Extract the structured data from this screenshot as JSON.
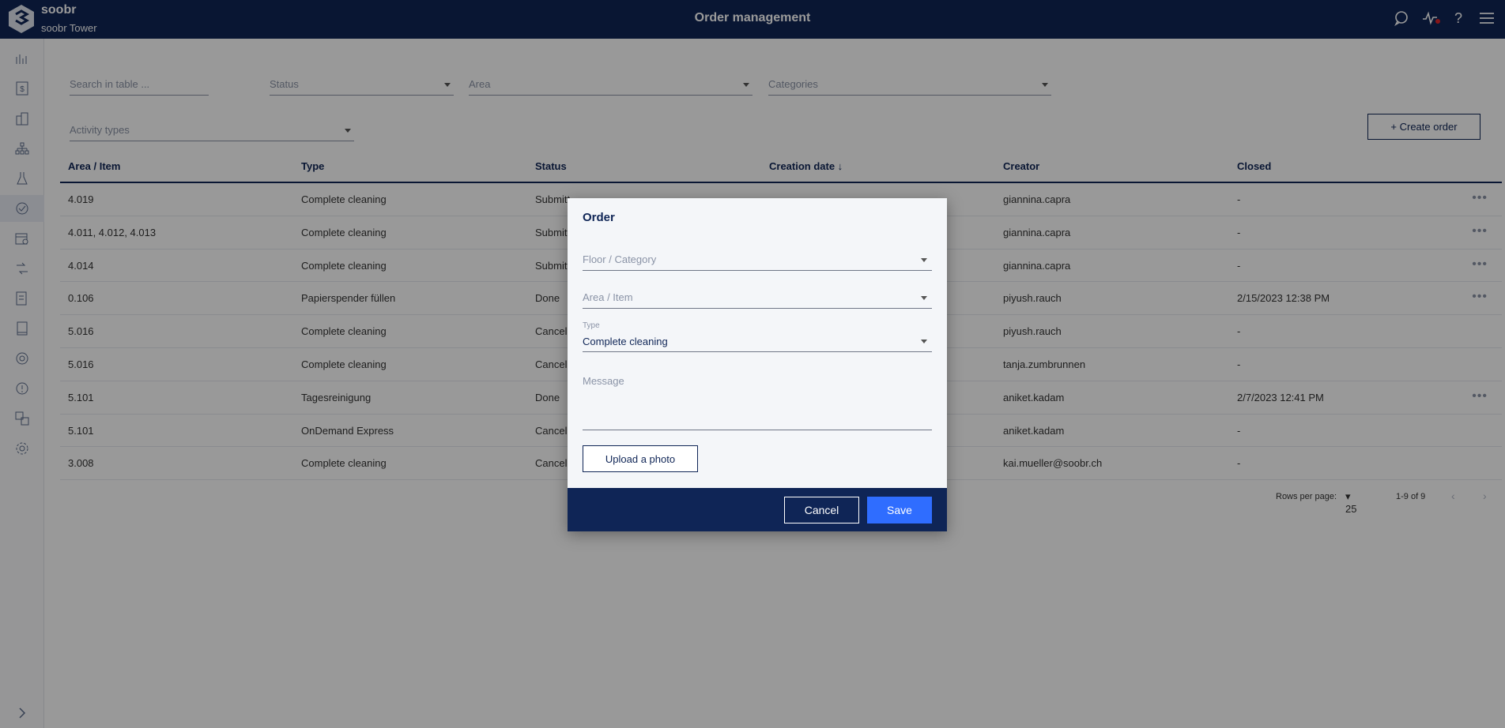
{
  "header": {
    "brand": "soobr",
    "building": "soobr Tower",
    "title": "Order management"
  },
  "filters": {
    "search_placeholder": "Search in table ...",
    "status": "Status",
    "area": "Area",
    "categories": "Categories",
    "activity_types": "Activity types"
  },
  "create_order_label": "+ Create order",
  "table": {
    "columns": [
      "Area / Item",
      "Type",
      "Status",
      "Creation date ↓",
      "Creator",
      "Closed"
    ],
    "rows": [
      {
        "area": "4.019",
        "type": "Complete cleaning",
        "status": "Submitt",
        "creator": "giannina.capra",
        "closed": "-",
        "more": true
      },
      {
        "area": "4.011, 4.012, 4.013",
        "type": "Complete cleaning",
        "status": "Submitt",
        "creator": "giannina.capra",
        "closed": "-",
        "more": true
      },
      {
        "area": "4.014",
        "type": "Complete cleaning",
        "status": "Submitt",
        "creator": "giannina.capra",
        "closed": "-",
        "more": true
      },
      {
        "area": "0.106",
        "type": "Papierspender füllen",
        "status": "Done",
        "creator": "piyush.rauch",
        "closed": "2/15/2023 12:38 PM",
        "more": true
      },
      {
        "area": "5.016",
        "type": "Complete cleaning",
        "status": "Cancel",
        "creator": "piyush.rauch",
        "closed": "-",
        "more": false
      },
      {
        "area": "5.016",
        "type": "Complete cleaning",
        "status": "Cancel",
        "creator": "tanja.zumbrunnen",
        "closed": "-",
        "more": false
      },
      {
        "area": "5.101",
        "type": "Tagesreinigung",
        "status": "Done",
        "creator": "aniket.kadam",
        "closed": "2/7/2023 12:41 PM",
        "more": true
      },
      {
        "area": "5.101",
        "type": "OnDemand Express",
        "status": "Cancel",
        "creator": "aniket.kadam",
        "closed": "-",
        "more": false
      },
      {
        "area": "3.008",
        "type": "Complete cleaning",
        "status": "Cancel",
        "creator": "kai.mueller@soobr.ch",
        "closed": "-",
        "more": false
      }
    ]
  },
  "pagination": {
    "rows_per_page_label": "Rows per page:",
    "rows_per_page": "25",
    "range": "1-9 of 9"
  },
  "modal": {
    "title": "Order",
    "floor_category_placeholder": "Floor / Category",
    "area_item_placeholder": "Area / Item",
    "type_label": "Type",
    "type_value": "Complete cleaning",
    "message_placeholder": "Message",
    "upload_label": "Upload a photo",
    "cancel_label": "Cancel",
    "save_label": "Save"
  },
  "colors": {
    "navy": "#0f2556",
    "primary": "#2f6dff",
    "notification": "#e0262b"
  }
}
